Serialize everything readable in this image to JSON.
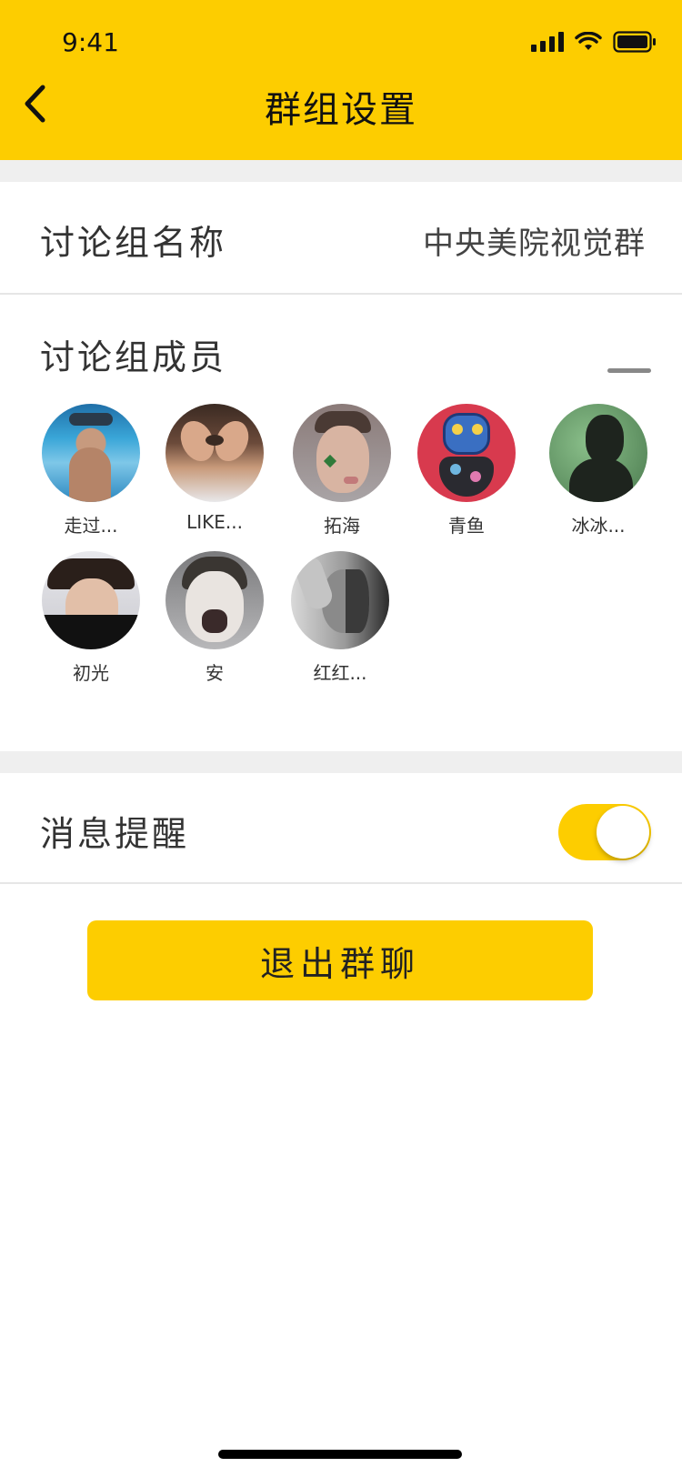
{
  "status_bar": {
    "time": "9:41"
  },
  "header": {
    "title": "群组设置"
  },
  "group_name": {
    "label": "讨论组名称",
    "value": "中央美院视觉群"
  },
  "members": {
    "label": "讨论组成员",
    "items": [
      {
        "name": "走过..."
      },
      {
        "name": "LIKE..."
      },
      {
        "name": "拓海"
      },
      {
        "name": "青鱼"
      },
      {
        "name": "冰冰..."
      },
      {
        "name": "初光"
      },
      {
        "name": "安"
      },
      {
        "name": "红红..."
      }
    ]
  },
  "notification": {
    "label": "消息提醒",
    "enabled": true
  },
  "exit_button": {
    "label": "退出群聊"
  },
  "colors": {
    "accent": "#FDCD00",
    "divider": "#efefef"
  }
}
